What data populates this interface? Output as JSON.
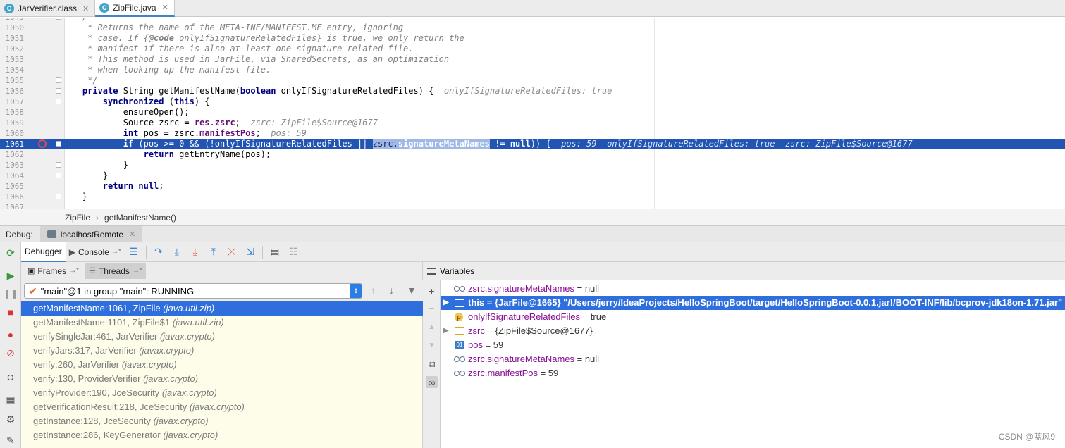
{
  "editor_tabs": [
    {
      "label": "JarVerifier.class",
      "icon": "class-icon",
      "active": false
    },
    {
      "label": "ZipFile.java",
      "icon": "class-icon",
      "active": true
    }
  ],
  "code_lines": [
    {
      "n": "1049",
      "html": "    <span class='cmt'>/**</span>"
    },
    {
      "n": "1050",
      "html": "     <span class='cmt'>* Returns the name of the META-INF/MANIFEST.MF entry, ignoring</span>"
    },
    {
      "n": "1051",
      "html": "     <span class='cmt'>* case. If {<b><u>@code</u></b> onlyIfSignatureRelatedFiles} is true, we only return the</span>"
    },
    {
      "n": "1052",
      "html": "     <span class='cmt'>* manifest if there is also at least one signature-related file.</span>"
    },
    {
      "n": "1053",
      "html": "     <span class='cmt'>* This method is used in JarFile, via SharedSecrets, as an optimization</span>"
    },
    {
      "n": "1054",
      "html": "     <span class='cmt'>* when looking up the manifest file.</span>"
    },
    {
      "n": "1055",
      "html": "     <span class='cmt'>*/</span>"
    },
    {
      "n": "1056",
      "html": "    <span class='kw'>private</span> String getManifestName(<span class='kw'>boolean</span> onlyIfSignatureRelatedFiles) {  <span class='inl'>onlyIfSignatureRelatedFiles: true</span>"
    },
    {
      "n": "1057",
      "html": "        <span class='kw'>synchronized</span> (<span class='kw'>this</span>) {"
    },
    {
      "n": "1058",
      "html": "            ensureOpen();"
    },
    {
      "n": "1059",
      "html": "            Source zsrc = <span class='fld'>res</span>.<span class='fld'>zsrc</span>;  <span class='inl'>zsrc: ZipFile$Source@1677</span>"
    },
    {
      "n": "1060",
      "html": "            <span class='kw'>int</span> pos = zsrc.<span class='fld'>manifestPos</span>;  <span class='inl'>pos: 59</span>"
    },
    {
      "n": "1061",
      "html": "            <span class='kw'>if</span> (pos >= 0 && (!onlyIfSignatureRelatedFiles || <span class='sel'>zsrc.<span class='fld'>signatureMetaNames</span></span> != <span class='kw'>null</span>)) {  <span class='inl'>pos: 59  onlyIfSignatureRelatedFiles: true  zsrc: ZipFile$Source@1677</span>",
      "exec": true
    },
    {
      "n": "1062",
      "html": "                <span class='kw'>return</span> getEntryName(pos);"
    },
    {
      "n": "1063",
      "html": "            }"
    },
    {
      "n": "1064",
      "html": "        }"
    },
    {
      "n": "1065",
      "html": "        <span class='kw'>return null</span>;"
    },
    {
      "n": "1066",
      "html": "    }"
    },
    {
      "n": "1067",
      "html": ""
    }
  ],
  "breadcrumb": [
    "ZipFile",
    "getManifestName()"
  ],
  "debug": {
    "label": "Debug:",
    "run_config": "localhostRemote",
    "tab_debugger": "Debugger",
    "tab_console": "Console",
    "console_suffix": "→*"
  },
  "frames": {
    "tab_frames": "Frames",
    "tab_threads": "Threads",
    "pin_suffix": "→*",
    "thread": "\"main\"@1 in group \"main\": RUNNING",
    "items": [
      {
        "method": "getManifestName:1061, ZipFile",
        "pkg": "(java.util.zip)",
        "selected": true
      },
      {
        "method": "getManifestName:1101, ZipFile$1",
        "pkg": "(java.util.zip)"
      },
      {
        "method": "verifySingleJar:461, JarVerifier",
        "pkg": "(javax.crypto)"
      },
      {
        "method": "verifyJars:317, JarVerifier",
        "pkg": "(javax.crypto)"
      },
      {
        "method": "verify:260, JarVerifier",
        "pkg": "(javax.crypto)"
      },
      {
        "method": "verify:130, ProviderVerifier",
        "pkg": "(javax.crypto)"
      },
      {
        "method": "verifyProvider:190, JceSecurity",
        "pkg": "(javax.crypto)"
      },
      {
        "method": "getVerificationResult:218, JceSecurity",
        "pkg": "(javax.crypto)"
      },
      {
        "method": "getInstance:128, JceSecurity",
        "pkg": "(javax.crypto)"
      },
      {
        "method": "getInstance:286, KeyGenerator",
        "pkg": "(javax.crypto)"
      }
    ]
  },
  "variables": {
    "title": "Variables",
    "items": [
      {
        "icon": "watch",
        "name": "zsrc.signatureMetaNames",
        "value": " = null",
        "arrow": ""
      },
      {
        "icon": "list",
        "name": "this",
        "value": " = {JarFile@1665} \"/Users/jerry/IdeaProjects/HelloSpringBoot/target/HelloSpringBoot-0.0.1.jar!/BOOT-INF/lib/bcprov-jdk18on-1.71.jar\"",
        "arrow": "▶",
        "selected": true
      },
      {
        "icon": "p",
        "name": "onlyIfSignatureRelatedFiles",
        "value": " = true",
        "arrow": ""
      },
      {
        "icon": "z",
        "name": "zsrc",
        "value": " = {ZipFile$Source@1677}",
        "arrow": "▶"
      },
      {
        "icon": "01",
        "name": "pos",
        "value": " = 59",
        "arrow": ""
      },
      {
        "icon": "watch",
        "name": "zsrc.signatureMetaNames",
        "value": " = null",
        "arrow": ""
      },
      {
        "icon": "watch",
        "name": "zsrc.manifestPos",
        "value": " = 59",
        "arrow": ""
      }
    ]
  },
  "watermark": "CSDN @蓝风9"
}
